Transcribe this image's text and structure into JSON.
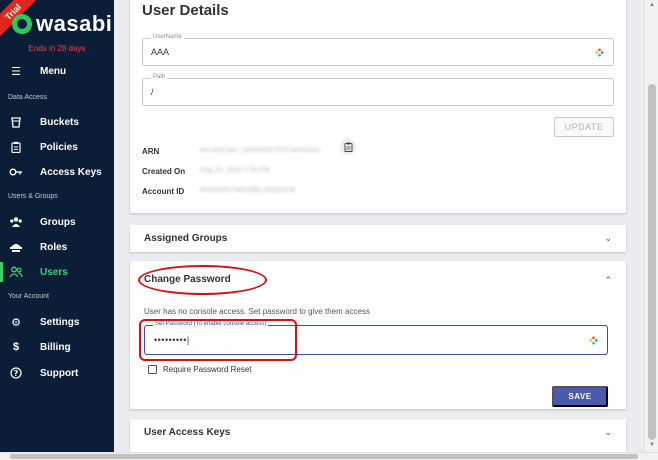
{
  "sidebar": {
    "trial_badge": "Trial",
    "brand": "wasabi",
    "trial_notice": "Ends in 28 days",
    "menu_label": "Menu",
    "sections": {
      "data_access": "Data Access",
      "users_groups": "Users & Groups",
      "your_account": "Your Account"
    },
    "items": {
      "buckets": "Buckets",
      "policies": "Policies",
      "access_keys": "Access Keys",
      "groups": "Groups",
      "roles": "Roles",
      "users": "Users",
      "settings": "Settings",
      "billing": "Billing",
      "support": "Support"
    },
    "accent_color": "#3ad16a",
    "background_color": "#0c1d38"
  },
  "user_details": {
    "title": "User Details",
    "username_label": "UserName",
    "username_value": "AAA",
    "path_label": "Path",
    "path_value": "/",
    "update_label": "UPDATE",
    "arn_label": "ARN",
    "arn_value": "arn:aws:iam::100000067976:user/AAA",
    "created_label": "Created On",
    "created_value": "Aug 20, 2020 1:55 PM",
    "account_label": "Account ID",
    "account_value": "8HRH0FLHN6X6BLUN321KW"
  },
  "assigned_groups": {
    "title": "Assigned Groups"
  },
  "change_password": {
    "title": "Change Password",
    "description": "User has no console access. Set password to give them access",
    "field_label": "Set Password (To enable console access)",
    "field_value": "•••••••••|",
    "require_reset_label": "Require Password Reset",
    "save_label": "SAVE",
    "save_color": "#4b5bab",
    "annotation_color": "#d0141c"
  },
  "user_access_keys": {
    "title": "User Access Keys"
  }
}
